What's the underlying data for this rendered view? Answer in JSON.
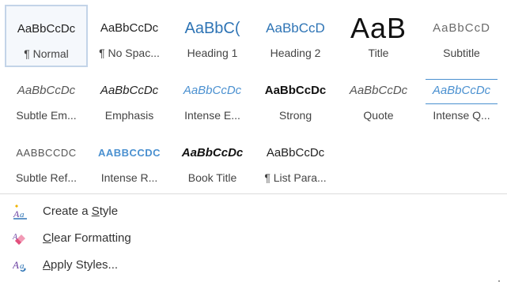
{
  "styles": [
    {
      "sample": "AaBbCcDc",
      "name": "¶ Normal",
      "selected": true
    },
    {
      "sample": "AaBbCcDc",
      "name": "¶ No Spac..."
    },
    {
      "sample": "AaBbC(",
      "name": "Heading 1"
    },
    {
      "sample": "AaBbCcD",
      "name": "Heading 2"
    },
    {
      "sample": "AaB",
      "name": "Title"
    },
    {
      "sample": "AaBbCcD",
      "name": "Subtitle"
    },
    {
      "sample": "AaBbCcDc",
      "name": "Subtle Em..."
    },
    {
      "sample": "AaBbCcDc",
      "name": "Emphasis"
    },
    {
      "sample": "AaBbCcDc",
      "name": "Intense E..."
    },
    {
      "sample": "AaBbCcDc",
      "name": "Strong"
    },
    {
      "sample": "AaBbCcDc",
      "name": "Quote"
    },
    {
      "sample": "AaBbCcDc",
      "name": "Intense Q..."
    },
    {
      "sample": "AaBbCcDc",
      "name": "Subtle Ref..."
    },
    {
      "sample": "AaBbCcDc",
      "name": "Intense R..."
    },
    {
      "sample": "AaBbCcDc",
      "name": "Book Title"
    },
    {
      "sample": "AaBbCcDc",
      "name": "¶ List Para..."
    }
  ],
  "menu": {
    "create_style": {
      "pre": "Create a ",
      "accel": "S",
      "post": "tyle"
    },
    "clear_formatting": {
      "pre": "",
      "accel": "C",
      "post": "lear Formatting"
    },
    "apply_styles": {
      "pre": "",
      "accel": "A",
      "post": "pply Styles..."
    }
  },
  "colors": {
    "heading_blue": "#2e74b5",
    "intense_blue": "#4a90d0",
    "selected_border": "#c3d4e8"
  },
  "icons": {
    "create_style": "create-style-icon",
    "clear_formatting": "eraser-icon",
    "apply_styles": "apply-styles-icon"
  }
}
